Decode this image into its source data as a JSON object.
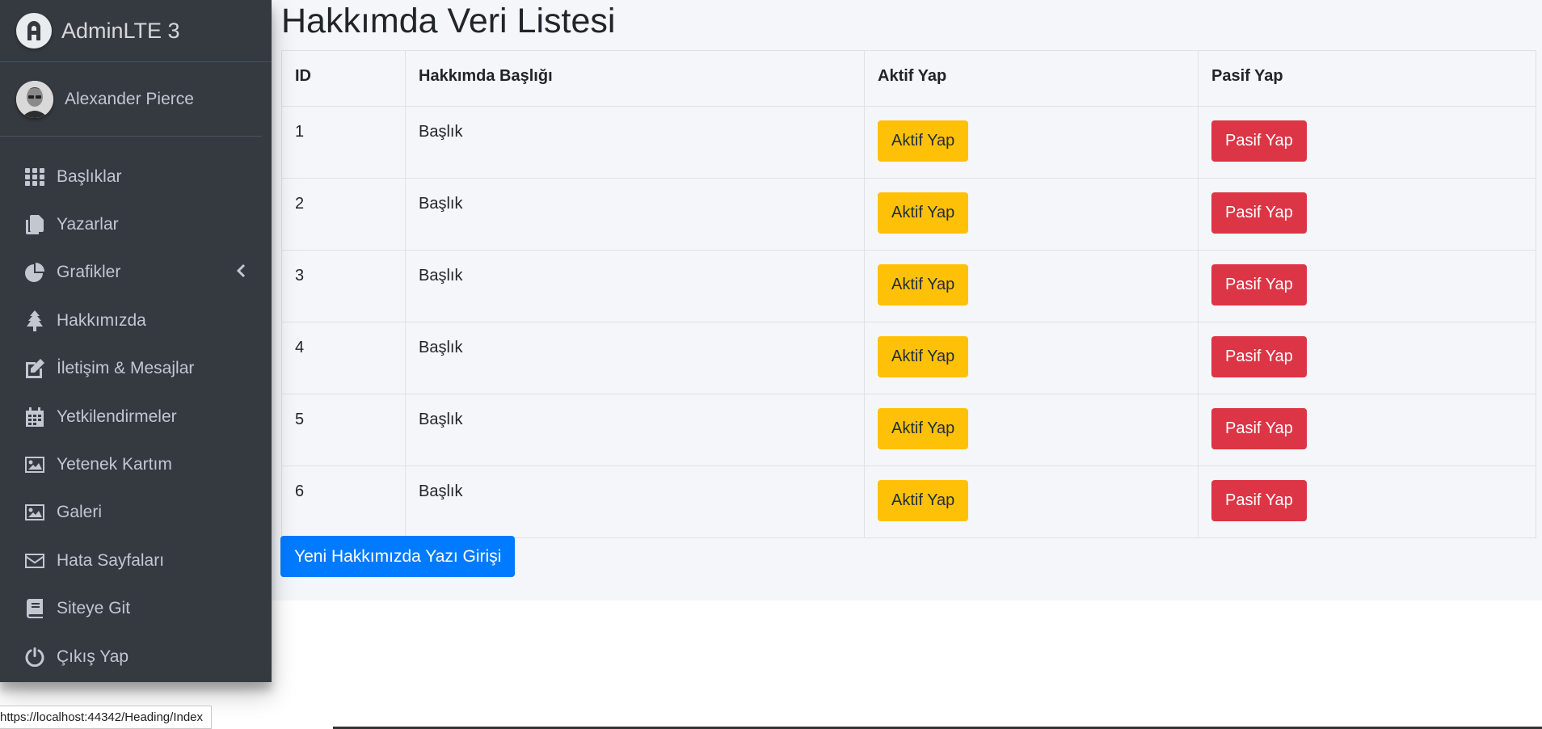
{
  "brand": {
    "name": "AdminLTE 3"
  },
  "user": {
    "name": "Alexander Pierce"
  },
  "sidebar": {
    "items": [
      {
        "label": "Başlıklar",
        "icon": "th-icon"
      },
      {
        "label": "Yazarlar",
        "icon": "copy-icon"
      },
      {
        "label": "Grafikler",
        "icon": "chart-pie-icon",
        "has_arrow": true
      },
      {
        "label": "Hakkımızda",
        "icon": "tree-icon"
      },
      {
        "label": "İletişim & Mesajlar",
        "icon": "edit-icon"
      },
      {
        "label": "Yetkilendirmeler",
        "icon": "calendar-icon"
      },
      {
        "label": "Yetenek Kartım",
        "icon": "image-icon"
      },
      {
        "label": "Galeri",
        "icon": "image-icon"
      },
      {
        "label": "Hata Sayfaları",
        "icon": "envelope-icon"
      },
      {
        "label": "Siteye Git",
        "icon": "book-icon"
      },
      {
        "label": "Çıkış Yap",
        "icon": "power-icon"
      }
    ]
  },
  "main": {
    "title": "Hakkımda Veri Listesi",
    "table": {
      "headers": [
        "ID",
        "Hakkımda Başlığı",
        "Aktif Yap",
        "Pasif Yap"
      ],
      "rows": [
        {
          "id": "1",
          "title": "Başlık",
          "aktif": "Aktif Yap",
          "pasif": "Pasif Yap"
        },
        {
          "id": "2",
          "title": "Başlık",
          "aktif": "Aktif Yap",
          "pasif": "Pasif Yap"
        },
        {
          "id": "3",
          "title": "Başlık",
          "aktif": "Aktif Yap",
          "pasif": "Pasif Yap"
        },
        {
          "id": "4",
          "title": "Başlık",
          "aktif": "Aktif Yap",
          "pasif": "Pasif Yap"
        },
        {
          "id": "5",
          "title": "Başlık",
          "aktif": "Aktif Yap",
          "pasif": "Pasif Yap"
        },
        {
          "id": "6",
          "title": "Başlık",
          "aktif": "Aktif Yap",
          "pasif": "Pasif Yap"
        }
      ]
    },
    "new_button": "Yeni Hakkımızda Yazı Girişi"
  },
  "status_bar": {
    "url": "https://localhost:44342/Heading/Index"
  },
  "colors": {
    "sidebar_bg": "#343a40",
    "warning": "#ffc107",
    "danger": "#dc3545",
    "primary": "#007bff",
    "content_bg": "#f4f6f9"
  }
}
